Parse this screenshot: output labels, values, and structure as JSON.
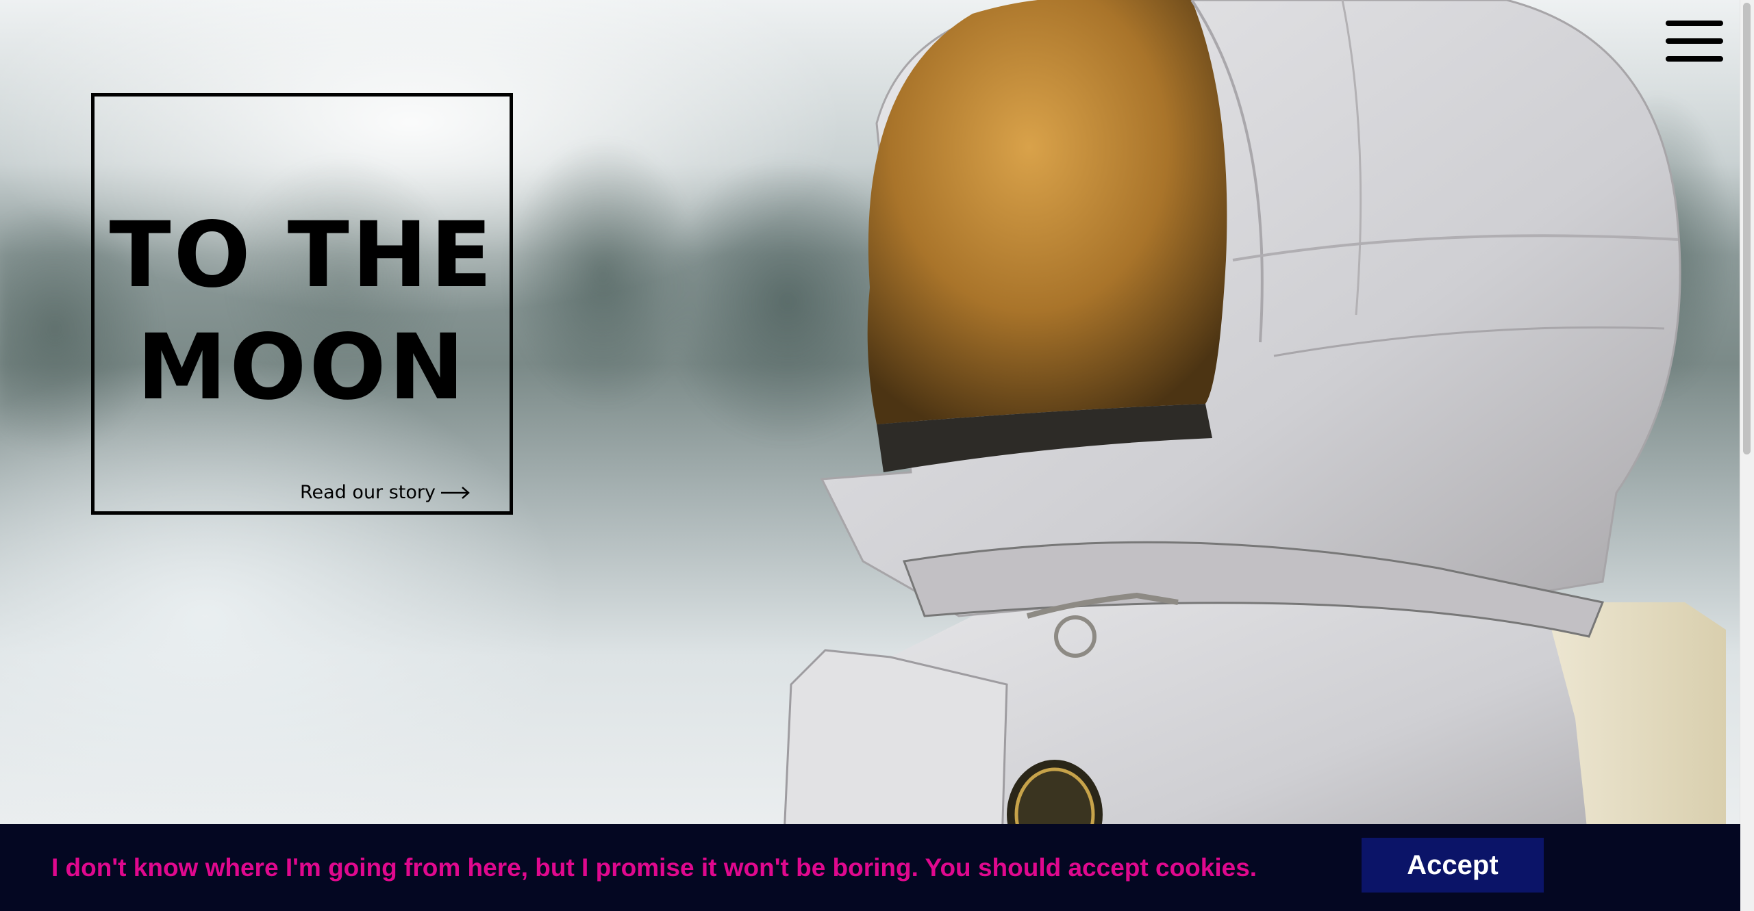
{
  "hero": {
    "title_line1": "TO THE",
    "title_line2": "MOON",
    "story_link": "Read our story"
  },
  "nav": {
    "menu_icon": "hamburger-menu-icon"
  },
  "cookie_banner": {
    "message": "I don't know where I'm going from here, but I promise it won't be boring. You should accept cookies.",
    "accept_label": "Accept"
  },
  "colors": {
    "banner_background": "#040722",
    "banner_text": "#e0088e",
    "accept_button": "#0b1468",
    "title_text": "#000000"
  }
}
